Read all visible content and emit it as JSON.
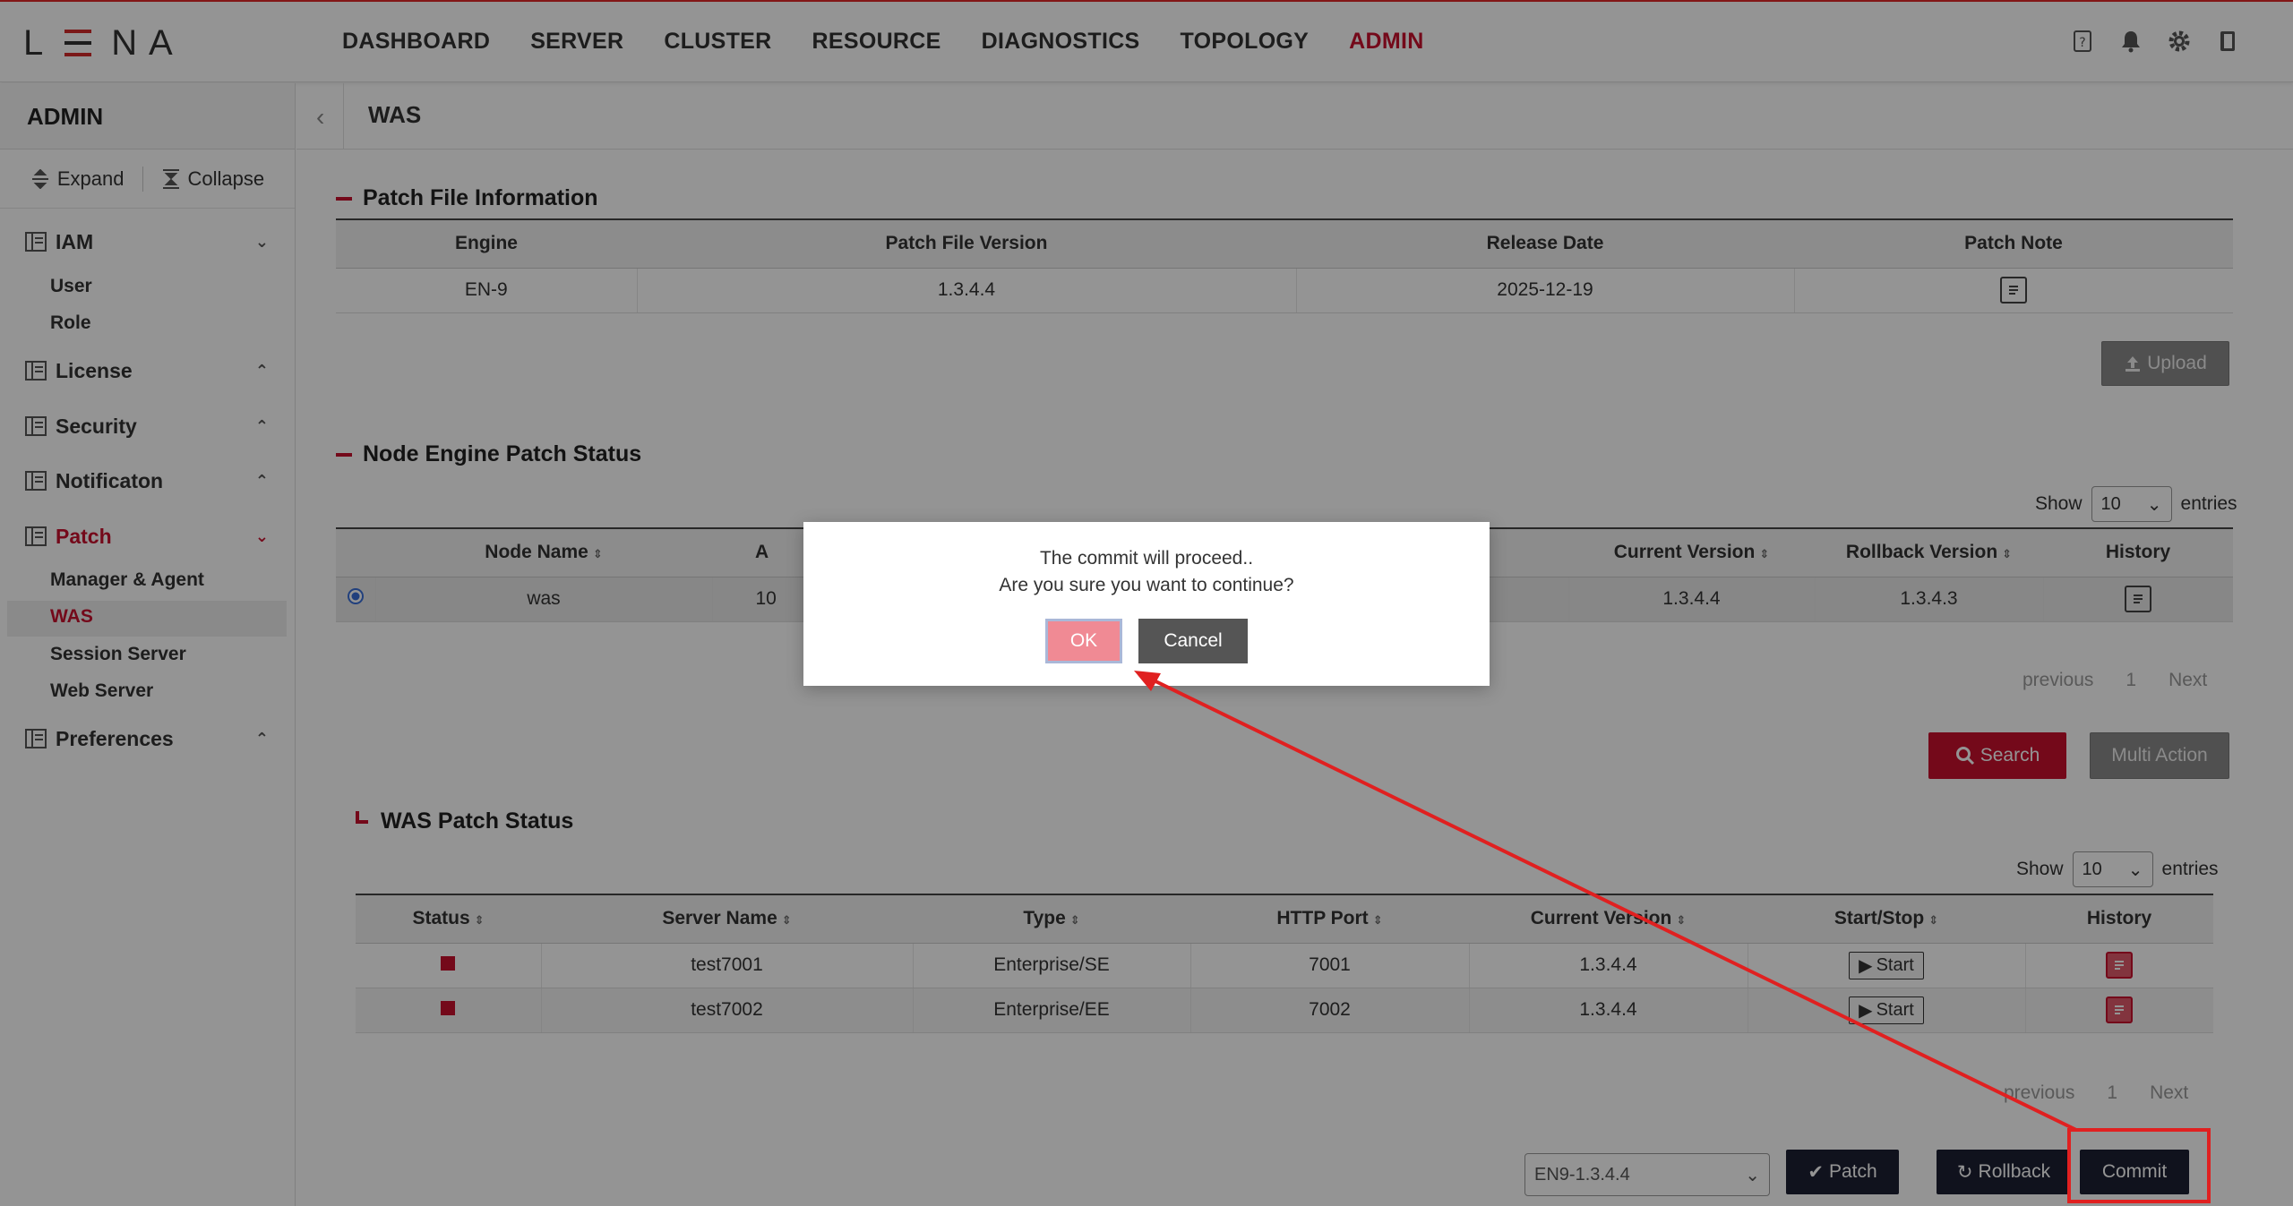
{
  "app": {
    "logo_l": "L",
    "logo_na": "N A"
  },
  "nav": [
    "DASHBOARD",
    "SERVER",
    "CLUSTER",
    "RESOURCE",
    "DIAGNOSTICS",
    "TOPOLOGY",
    "ADMIN"
  ],
  "nav_active": "ADMIN",
  "top_icons": [
    "help-icon",
    "bell-icon",
    "gear-icon",
    "book-icon"
  ],
  "sidebar": {
    "title": "ADMIN",
    "expand": "Expand",
    "collapse": "Collapse",
    "groups": [
      {
        "label": "IAM",
        "expanded": true,
        "items": [
          "User",
          "Role"
        ]
      },
      {
        "label": "License",
        "expanded": false
      },
      {
        "label": "Security",
        "expanded": false
      },
      {
        "label": "Notificaton",
        "expanded": false
      },
      {
        "label": "Patch",
        "expanded": true,
        "items": [
          "Manager & Agent",
          "WAS",
          "Session Server",
          "Web Server"
        ]
      },
      {
        "label": "Preferences",
        "expanded": false
      }
    ],
    "active_item": "WAS"
  },
  "page": {
    "title": "WAS"
  },
  "patch_file": {
    "title": "Patch File Information",
    "headers": [
      "Engine",
      "Patch File Version",
      "Release Date",
      "Patch Note"
    ],
    "rows": [
      [
        "EN-9",
        "1.3.4.4",
        "2025-12-19"
      ]
    ],
    "upload": "Upload"
  },
  "node_status": {
    "title": "Node Engine Patch Status",
    "show": "Show",
    "entries": "entries",
    "page_size": "10",
    "headers": [
      "Node Name",
      "A",
      "Current Version",
      "Rollback Version",
      "History"
    ],
    "rows": [
      {
        "node": "was",
        "col2": "10",
        "current": "1.3.4.4",
        "rollback": "1.3.4.3"
      }
    ],
    "pager": {
      "previous": "previous",
      "page": "1",
      "next": "Next"
    },
    "search": "Search",
    "multi_action": "Multi Action"
  },
  "was_status": {
    "title": "WAS Patch Status",
    "show": "Show",
    "entries": "entries",
    "page_size": "10",
    "headers": [
      "Status",
      "Server Name",
      "Type",
      "HTTP Port",
      "Current Version",
      "Start/Stop",
      "History"
    ],
    "rows": [
      {
        "server": "test7001",
        "type": "Enterprise/SE",
        "port": "7001",
        "version": "1.3.4.4",
        "action": "Start"
      },
      {
        "server": "test7002",
        "type": "Enterprise/EE",
        "port": "7002",
        "version": "1.3.4.4",
        "action": "Start"
      }
    ],
    "pager": {
      "previous": "previous",
      "page": "1",
      "next": "Next"
    }
  },
  "bottom": {
    "version_select": "EN9-1.3.4.4",
    "patch": "Patch",
    "rollback": "Rollback",
    "commit": "Commit"
  },
  "modal": {
    "line1": "The commit will proceed..",
    "line2": "Are you sure you want to continue?",
    "ok": "OK",
    "cancel": "Cancel"
  },
  "colors": {
    "accent": "#c8102e",
    "dark_button": "#1c2033",
    "annotation": "#e02020"
  }
}
